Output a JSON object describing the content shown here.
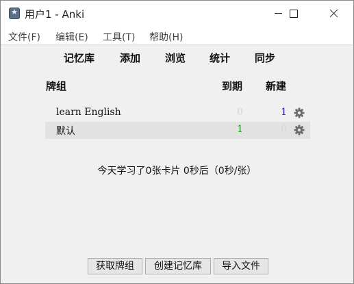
{
  "window": {
    "title": "用户1 - Anki"
  },
  "menu": [
    {
      "label": "文件(F)"
    },
    {
      "label": "编辑(E)"
    },
    {
      "label": "工具(T)"
    },
    {
      "label": "帮助(H)"
    }
  ],
  "toolbar": [
    {
      "label": "记忆库"
    },
    {
      "label": "添加"
    },
    {
      "label": "浏览"
    },
    {
      "label": "统计"
    },
    {
      "label": "同步"
    }
  ],
  "deck_table": {
    "headers": {
      "deck": "牌组",
      "due": "到期",
      "new": "新建"
    },
    "rows": [
      {
        "name": "learn English",
        "due": "0",
        "new": "1"
      },
      {
        "name": "默认",
        "due": "1",
        "new": "0"
      }
    ]
  },
  "stats_text": "今天学习了0张卡片 0秒后（0秒/张）",
  "buttons": [
    {
      "label": "获取牌组"
    },
    {
      "label": "创建记忆库"
    },
    {
      "label": "导入文件"
    }
  ],
  "icons": {
    "options": "gear-icon",
    "app": "anki-star-icon"
  },
  "colors": {
    "due_positive": "#1a8c1a",
    "new_positive": "#1a1aa6",
    "zero": "#d4d4d4",
    "selected_row": "#e2e2e2"
  }
}
